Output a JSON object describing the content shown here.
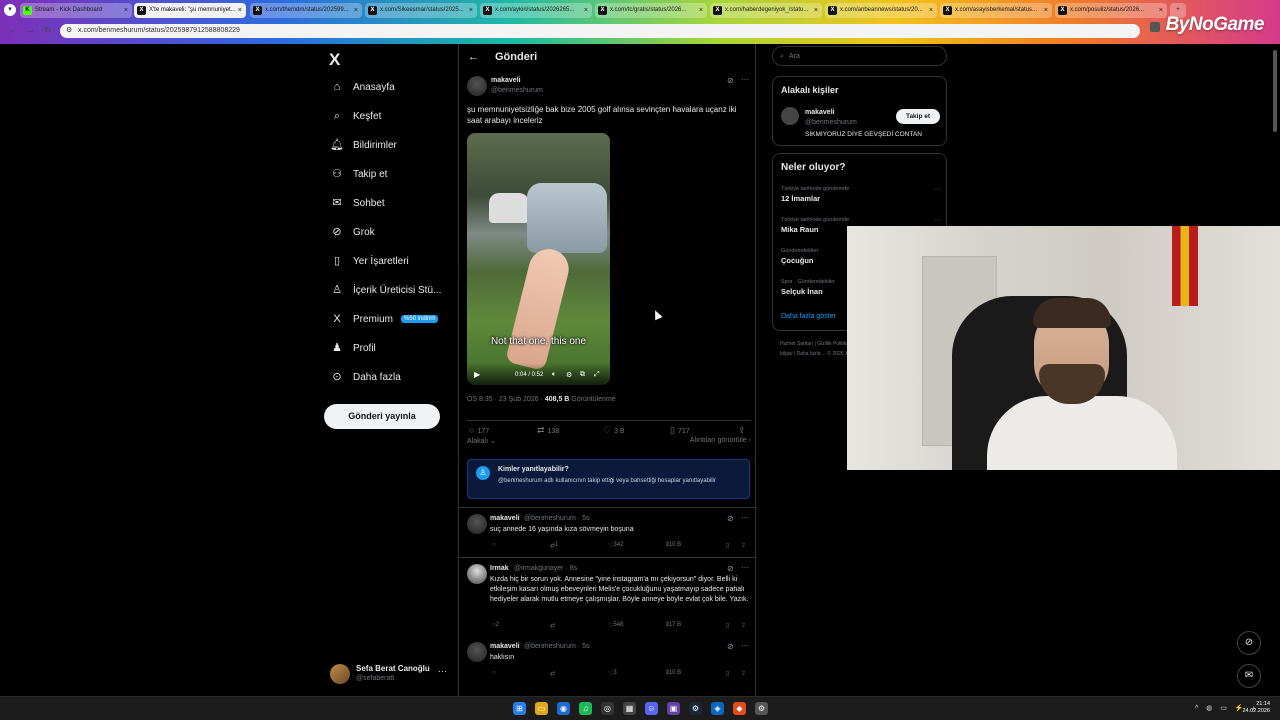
{
  "browser": {
    "tabs": [
      {
        "label": "Stream - Kick Dashboard",
        "favicon": "kick-icon"
      },
      {
        "label": "X'te makaveli: \"şu memnuniyet...",
        "favicon": "x-icon",
        "active": true
      },
      {
        "label": "x.com/themdm/status/202599...",
        "favicon": "x-icon"
      },
      {
        "label": "x.com/Sikeesmar/status/2025...",
        "favicon": "x-icon"
      },
      {
        "label": "x.com/aykiri/status/2026265...",
        "favicon": "x-icon"
      },
      {
        "label": "x.com/tc/gratis/status/2026...",
        "favicon": "x-icon"
      },
      {
        "label": "x.com/haberdegeniyok_/statu...",
        "favicon": "x-icon"
      },
      {
        "label": "x.com/anbeannews/status/20...",
        "favicon": "x-icon"
      },
      {
        "label": "x.com/asayisberkemal/status...",
        "favicon": "x-icon"
      },
      {
        "label": "x.com/posuliz/status/2026...",
        "favicon": "x-icon"
      }
    ],
    "url": "x.com/benmeshurum/status/2025987912588808229",
    "brand": "ByNoGame"
  },
  "nav": {
    "logo": "X",
    "items": [
      {
        "label": "Anasayfa",
        "icon": "home-icon"
      },
      {
        "label": "Keşfet",
        "icon": "search-icon"
      },
      {
        "label": "Bildirimler",
        "icon": "bell-icon"
      },
      {
        "label": "Takip et",
        "icon": "add-person-icon"
      },
      {
        "label": "Sohbet",
        "icon": "mail-icon"
      },
      {
        "label": "Grok",
        "icon": "grok-icon"
      },
      {
        "label": "Yer İşaretleri",
        "icon": "bookmark-icon"
      },
      {
        "label": "İçerik Üreticisi Stü...",
        "icon": "creator-icon"
      },
      {
        "label": "Premium",
        "icon": "x-premium-icon",
        "badge": "%50 indirim"
      },
      {
        "label": "Profil",
        "icon": "profile-icon"
      },
      {
        "label": "Daha fazla",
        "icon": "more-circle-icon"
      }
    ],
    "post_button": "Gönderi yayınla",
    "profile": {
      "name": "Sefa Berat Canoğlu",
      "handle": "@sefaberatt"
    }
  },
  "post": {
    "header": "Gönderi",
    "author": "makaveli",
    "handle": "@benmeshurum",
    "text": "şu memnuniyetsizliğe bak bize 2005 golf alınsa sevinçten havalara uçanz iki saat arabayı inceleriz",
    "video": {
      "subtitle": "Not that one, this one",
      "time": "0:04 / 0:52"
    },
    "timestamp": "ÖS 8:35 · 23 Şub 2026 · ",
    "views": "408,5 B",
    "views_label": " Görüntülenme",
    "actions": {
      "replies": "177",
      "reposts": "138",
      "likes": "3 B",
      "bookmarks": "717"
    },
    "related_left": "Alakalı",
    "related_right": "Alıntıları görüntüle"
  },
  "reply_restriction": {
    "title": "Kimler yanıtlayabilir?",
    "desc": "@benmeshurum adlı kullanıcının takip ettiği veya bahsettiği hesaplar yanıtlayabilir"
  },
  "replies": [
    {
      "name": "makaveli",
      "meta": "@benmeshurum · 5s",
      "text": "suç annede 16 yaşında kıza sövmeyin boşuna",
      "reposts": "1",
      "likes": "342",
      "views": "10 B"
    },
    {
      "name": "Irmak",
      "meta": "@irmakgunayer · 8s",
      "text": "Kızda hiç bir sorun yok. Annesine \"yine instagram'a mı çekiyorsun\" diyor. Belli ki etkileşim kasarı olmuş ebeveynleri Melis'e çocukluğunu yaşatmayıp sadece pahalı hediyeler alarak mutlu etmeye çalışmışlar. Böyle anneye böyle evlat çok bile. Yazık.",
      "replies": "2",
      "likes": "548",
      "views": "17 B"
    },
    {
      "name": "makaveli",
      "meta": "@benmeshurum · 5s",
      "text": "haklısın",
      "likes": "3",
      "views": "10 B"
    }
  ],
  "sidebar": {
    "search_placeholder": "Ara",
    "related_title": "Alakalı kişiler",
    "related_person": {
      "name": "makaveli",
      "handle": "@benmeshurum",
      "bio": "SIKMIYORUZ DİYE GEVŞEDİ CONTAN",
      "follow": "Takip et"
    },
    "trends_title": "Neler oluyor?",
    "trends": [
      {
        "context": "Türkiye tarihinde gündemde",
        "name": "12 İmamlar"
      },
      {
        "context": "Türkiye tarihinde gündemde",
        "name": "Mika Raun"
      },
      {
        "context": "Gündemdekiler",
        "name": "Çocuğun"
      },
      {
        "context": "Spor · Gündemdekiler",
        "name": "Selçuk İnan"
      }
    ],
    "show_more": "Daha fazla göster",
    "footer": "Hizmet Şartları | Gizlilik Politikası | Çerez Politikası | Erişilebilirlik | Reklam bilgisi | Daha fazla ... © 2026 X Corp."
  },
  "taskbar": {
    "time": "21:14",
    "date": "24.02.2026"
  }
}
